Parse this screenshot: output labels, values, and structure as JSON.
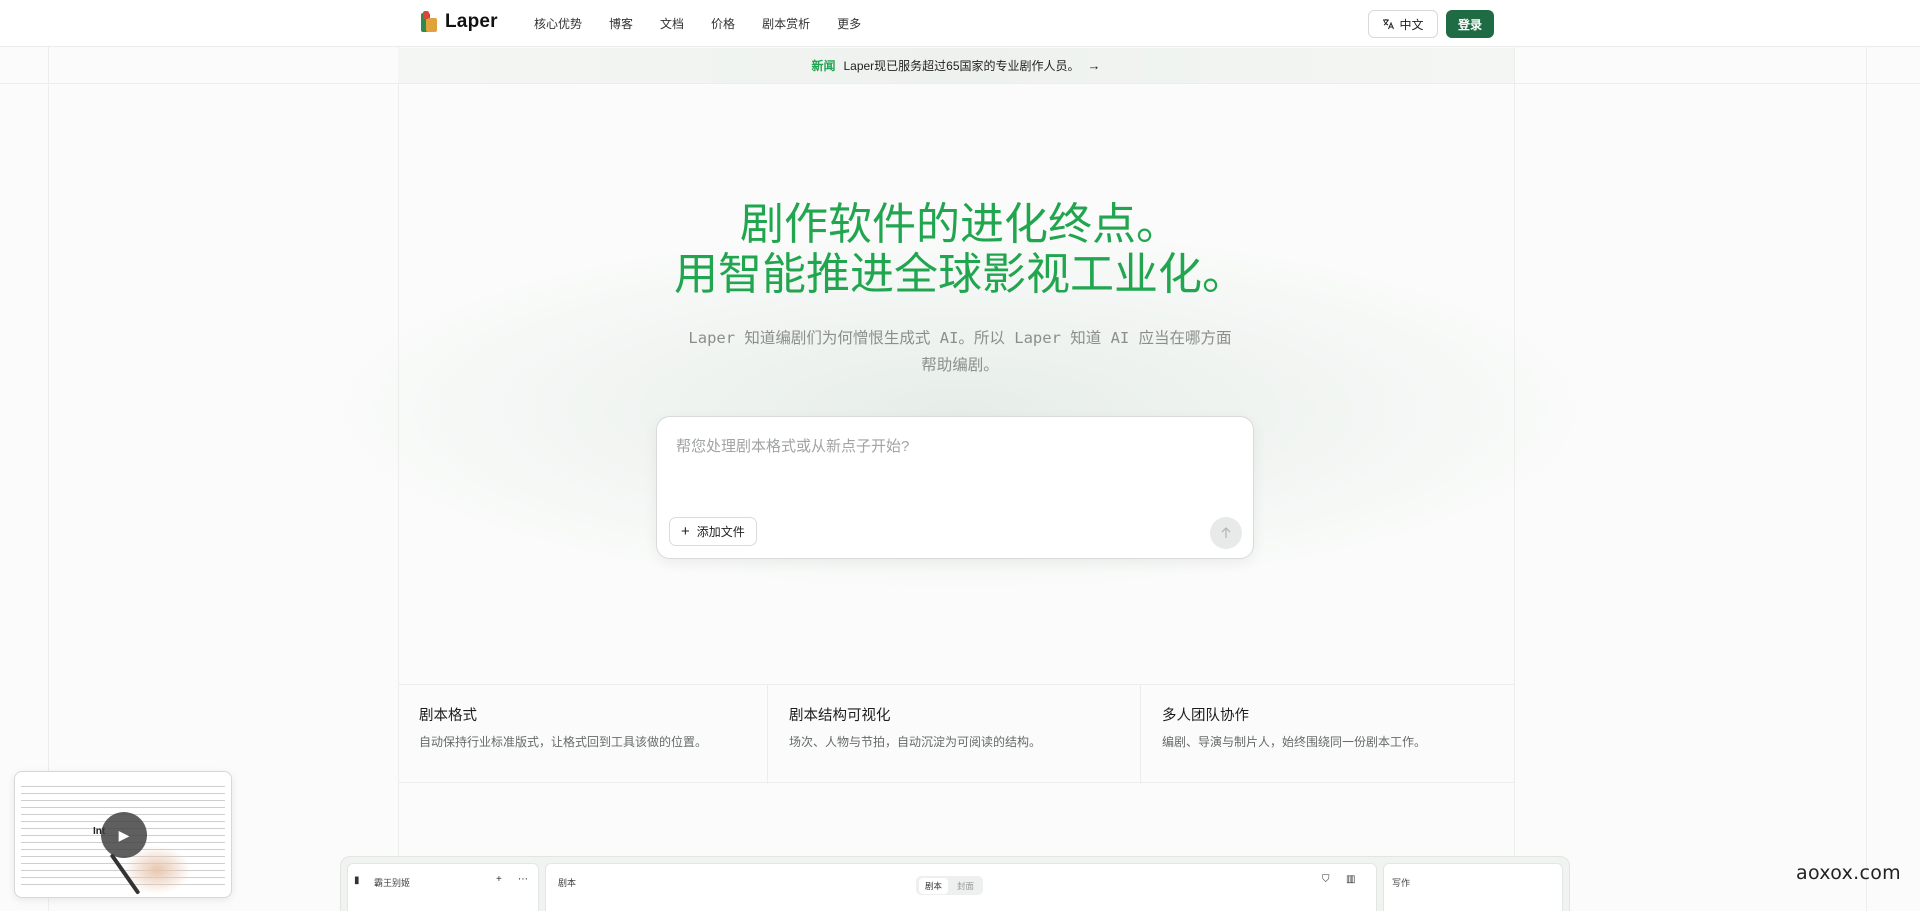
{
  "brand": {
    "name": "Laper"
  },
  "nav": {
    "items": [
      "核心优势",
      "博客",
      "文档",
      "价格",
      "剧本赏析",
      "更多"
    ],
    "lang_label": "中文",
    "login_label": "登录"
  },
  "announcement": {
    "tag": "新闻",
    "text": "Laper现已服务超过65国家的专业剧作人员。",
    "arrow": "→"
  },
  "hero": {
    "title_line1": "剧作软件的进化终点。",
    "title_line2": "用智能推进全球影视工业化。",
    "subtitle_line1": "Laper 知道编剧们为何憎恨生成式 AI。所以 Laper 知道 AI 应当在哪方面",
    "subtitle_line2": "帮助编剧。"
  },
  "prompt": {
    "placeholder": "帮您处理剧本格式或从新点子开始?",
    "add_file_label": "添加文件",
    "send_icon": "arrow-up-icon"
  },
  "features": [
    {
      "title": "剧本格式",
      "desc": "自动保持行业标准版式，让格式回到工具该做的位置。"
    },
    {
      "title": "剧本结构可视化",
      "desc": "场次、人物与节拍，自动沉淀为可阅读的结构。"
    },
    {
      "title": "多人团队协作",
      "desc": "编剧、导演与制片人，始终围绕同一份剧本工作。"
    }
  ],
  "preview": {
    "project_name": "霸王别姬",
    "script_label": "剧本",
    "tab_script": "剧本",
    "tab_cover": "封面",
    "write_label": "写作"
  },
  "video": {
    "label": "Int"
  },
  "watermark": "aoxox.com",
  "colors": {
    "accent": "#21a64f",
    "login_bg": "#1f6b43",
    "tag": "#22a352"
  }
}
